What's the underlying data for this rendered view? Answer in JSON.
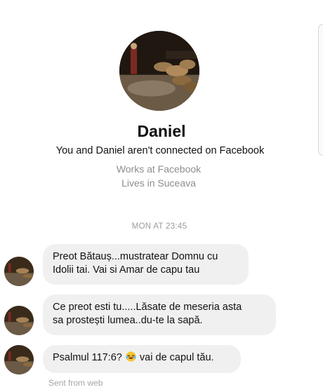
{
  "profile": {
    "name": "Daniel",
    "connection_status": "You and Daniel aren't connected on Facebook",
    "work": "Works at Facebook",
    "location": "Lives in Suceava"
  },
  "conversation": {
    "timestamp": "MON AT 23:45",
    "messages": [
      {
        "line1": "Preot Bătauș...mustratear Domnu cu",
        "line2": "Idolii tai. Vai si Amar de capu tau"
      },
      {
        "line1": "Ce preot esti tu.....Lăsate de meseria asta",
        "line2": "sa prostești lumea..du-te la sapă."
      },
      {
        "before_emoji": "Psalmul 117:6? ",
        "emoji": "laughing-crying-emoji",
        "after_emoji": " vai de capul tău."
      }
    ],
    "sent_from": "Sent from web"
  }
}
